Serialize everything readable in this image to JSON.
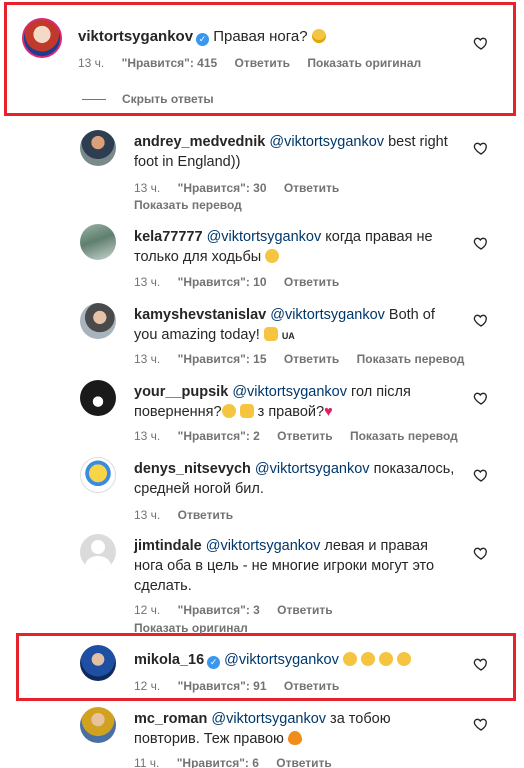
{
  "main_comment": {
    "username": "viktortsygankov",
    "verified": true,
    "text": "Правая нога?",
    "time": "13 ч.",
    "likes": "\"Нравится\": 415",
    "reply": "Ответить",
    "show_original": "Показать оригинал",
    "hide_replies": "Скрыть ответы"
  },
  "replies": [
    {
      "username": "andrey_medvednik",
      "mention": "@viktortsygankov",
      "text_line1": " best right",
      "text_line2": "foot in England))",
      "time": "13 ч.",
      "likes": "\"Нравится\": 30",
      "reply": "Ответить",
      "extra": "Показать перевод"
    },
    {
      "username": "kela77777",
      "mention": "@viktortsygankov",
      "text_line1": " когда правая не",
      "text_line2": "только для ходьбы",
      "time": "13 ч.",
      "likes": "\"Нравится\": 10",
      "reply": "Ответить"
    },
    {
      "username": "kamyshevstanislav",
      "mention": "@viktortsygankov",
      "text_line1": " Both of",
      "text_line2": "you amazing today!",
      "flag_text": "UA",
      "time": "13 ч.",
      "likes": "\"Нравится\": 15",
      "reply": "Ответить",
      "extra": "Показать перевод"
    },
    {
      "username": "your__pupsik",
      "mention": "@viktortsygankov",
      "text_line1": " гол після",
      "text_line2a": "повернення?",
      "text_line2b": " з правой?",
      "time": "13 ч.",
      "likes": "\"Нравится\": 2",
      "reply": "Ответить",
      "extra": "Показать перевод"
    },
    {
      "username": "denys_nitsevych",
      "mention": "@viktortsygankov",
      "text_line1": " показалось,",
      "text_line2": "средней ногой бил.",
      "time": "13 ч.",
      "reply": "Ответить"
    },
    {
      "username": "jimtindale",
      "mention": "@viktortsygankov",
      "text_line1": " левая и правая",
      "text_line2": "нога оба в цель - не многие игроки могут это",
      "text_line3": "сделать.",
      "time": "12 ч.",
      "likes": "\"Нравится\": 3",
      "reply": "Ответить",
      "extra": "Показать оригинал"
    },
    {
      "username": "mikola_16",
      "verified": true,
      "mention": "@viktortsygankov",
      "time": "12 ч.",
      "likes": "\"Нравится\": 91",
      "reply": "Ответить"
    },
    {
      "username": "mc_roman",
      "mention": "@viktortsygankov",
      "text_line1": " за тобою",
      "text_line2": "повторив. Теж правою",
      "time": "11 ч.",
      "likes": "\"Нравится\": 6",
      "reply": "Ответить"
    }
  ],
  "colors": {
    "highlight": "#e8222a",
    "verified": "#3897f0",
    "mention": "#00376b",
    "meta": "#737373"
  }
}
